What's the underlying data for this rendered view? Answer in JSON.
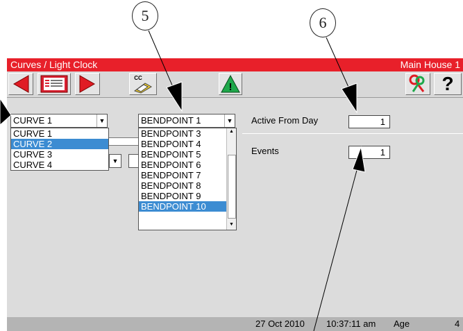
{
  "callouts": [
    "5",
    "6"
  ],
  "titlebar": {
    "title": "Curves / Light Clock",
    "house": "Main House 1"
  },
  "toolbar": {
    "icons": [
      "previous-icon",
      "list-icon",
      "next-icon",
      "copy-curve-icon",
      "alarm-icon",
      "key-icon",
      "help-icon"
    ],
    "copy_label": "CC",
    "alarm_glyph": "!",
    "help_label": "?"
  },
  "curve_select": {
    "value": "CURVE 1",
    "options": [
      "CURVE 1",
      "CURVE 2",
      "CURVE 3",
      "CURVE 4"
    ],
    "highlighted": "CURVE 2"
  },
  "bendpoint_select": {
    "value": "BENDPOINT 1",
    "options": [
      "BENDPOINT 3",
      "BENDPOINT 4",
      "BENDPOINT 5",
      "BENDPOINT 6",
      "BENDPOINT 7",
      "BENDPOINT 8",
      "BENDPOINT 9",
      "BENDPOINT 10"
    ],
    "highlighted": "BENDPOINT 10"
  },
  "fields": {
    "active_from_day": {
      "label": "Active From Day",
      "value": "1"
    },
    "events": {
      "label": "Events",
      "value": "1"
    }
  },
  "status": {
    "date": "27 Oct 2010",
    "time": "10:37:11 am",
    "age_label": "Age",
    "age_value": "4"
  },
  "colors": {
    "titlebar": "#e8202a",
    "selection": "#3c8cd2",
    "arrow_red": "#e01c24",
    "alarm_green": "#1ea84a"
  }
}
